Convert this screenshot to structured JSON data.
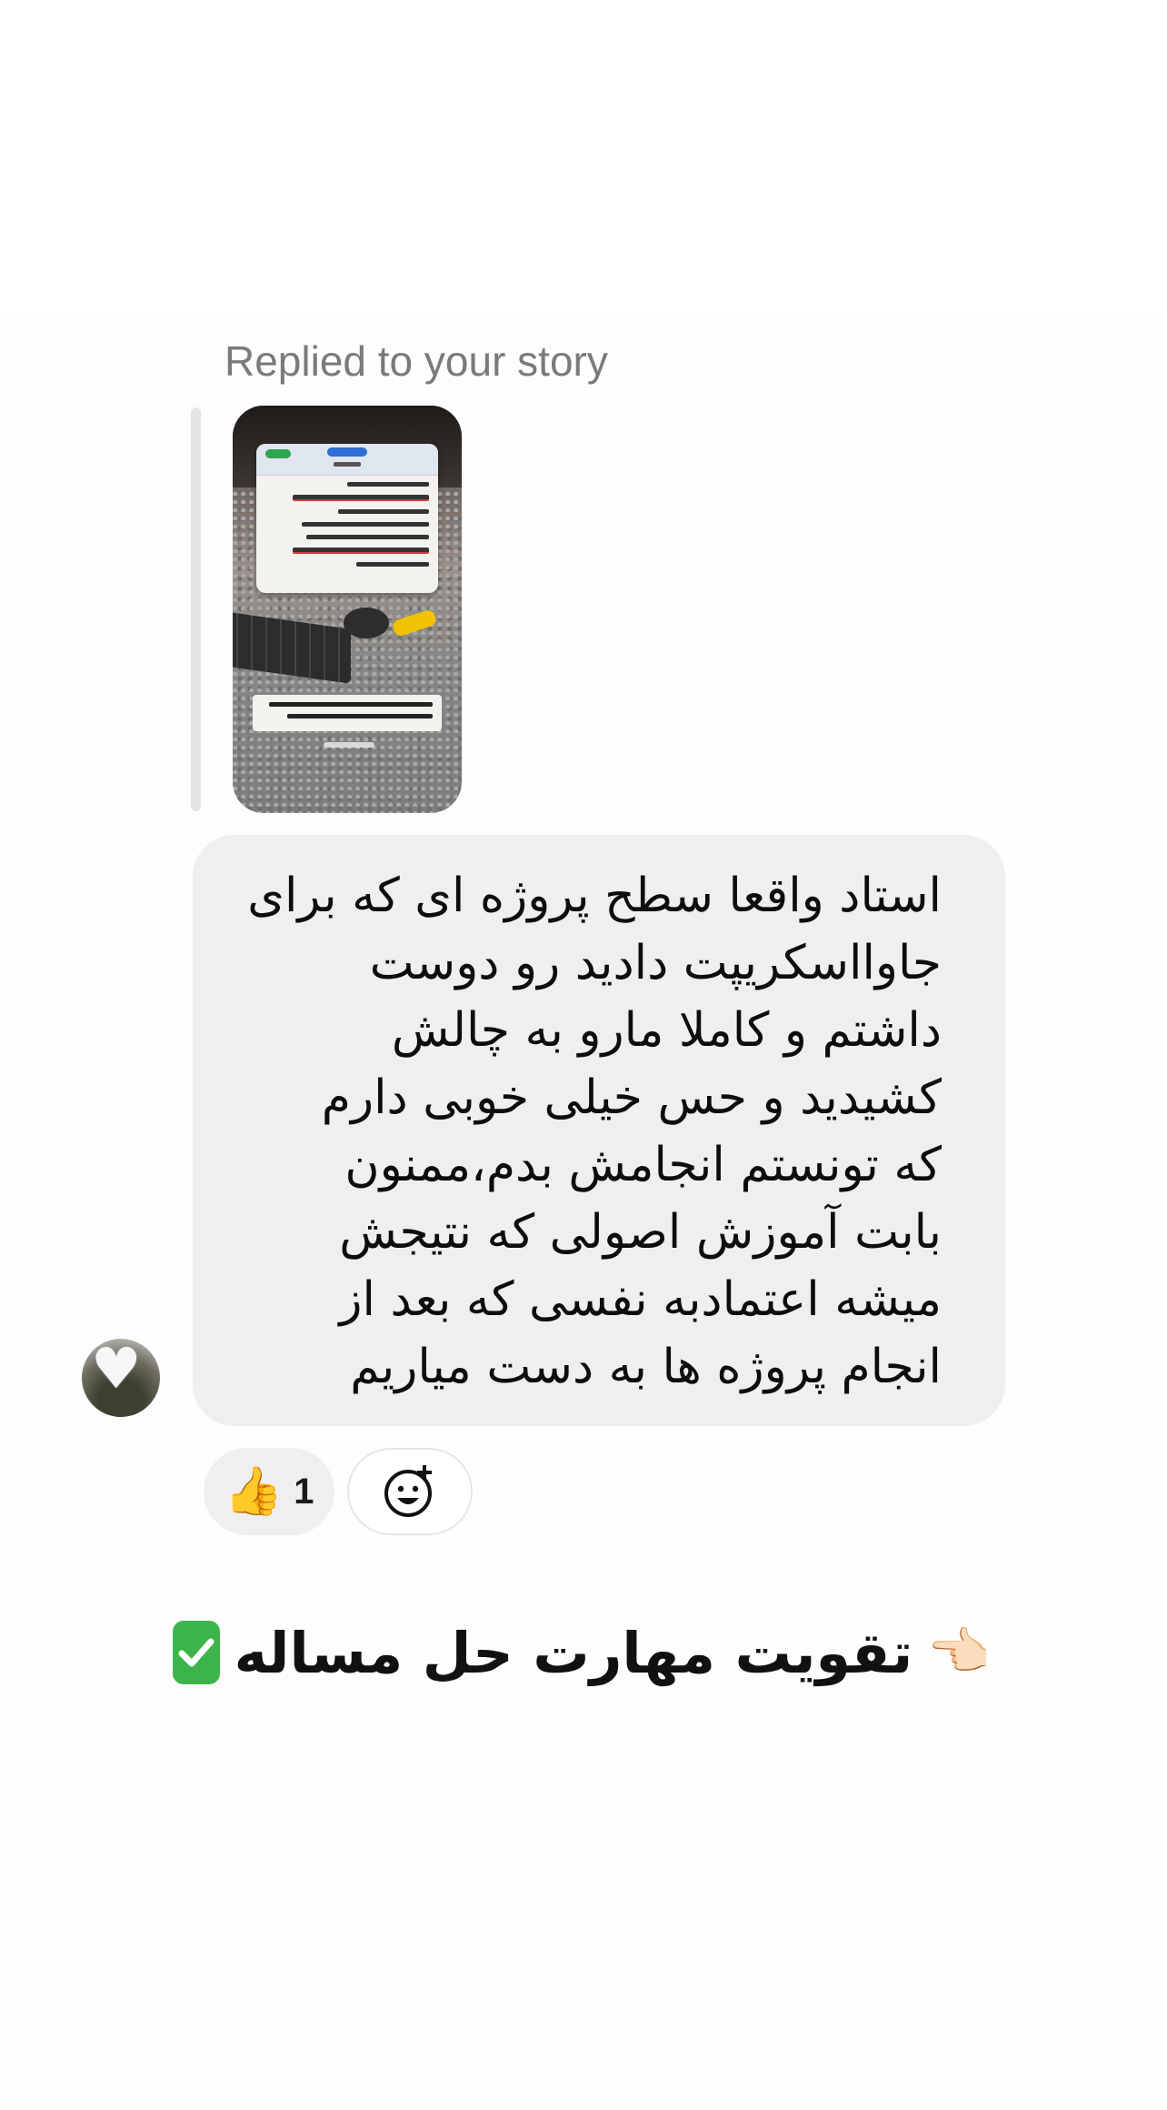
{
  "story_reply": {
    "label": "Replied to your story"
  },
  "message": {
    "text": "استاد واقعا سطح پروژه ای که برای\nجاوااسکریپت دادید رو دوست\nداشتم و کاملا مارو به چالش\nکشیدید و حس خیلی خوبی دارم\nکه تونستم انجامش بدم،ممنون\nبابت آموزش اصولی که نتیجش\nمیشه اعتمادبه نفسی که بعد از\nانجام پروژه ها به دست میاریم"
  },
  "reactions": {
    "emoji": "👍",
    "count": "1",
    "add_icon": "add-reaction-icon"
  },
  "avatar": {
    "icon": "white-heart"
  },
  "headline": {
    "text": "تقویت مهارت حل مساله",
    "check_icon": "check-mark-button",
    "pointer_icon": "pointing-hand"
  },
  "colors": {
    "bubble": "#efefef",
    "label": "#7a7a7a",
    "check": "#3bb54a"
  }
}
